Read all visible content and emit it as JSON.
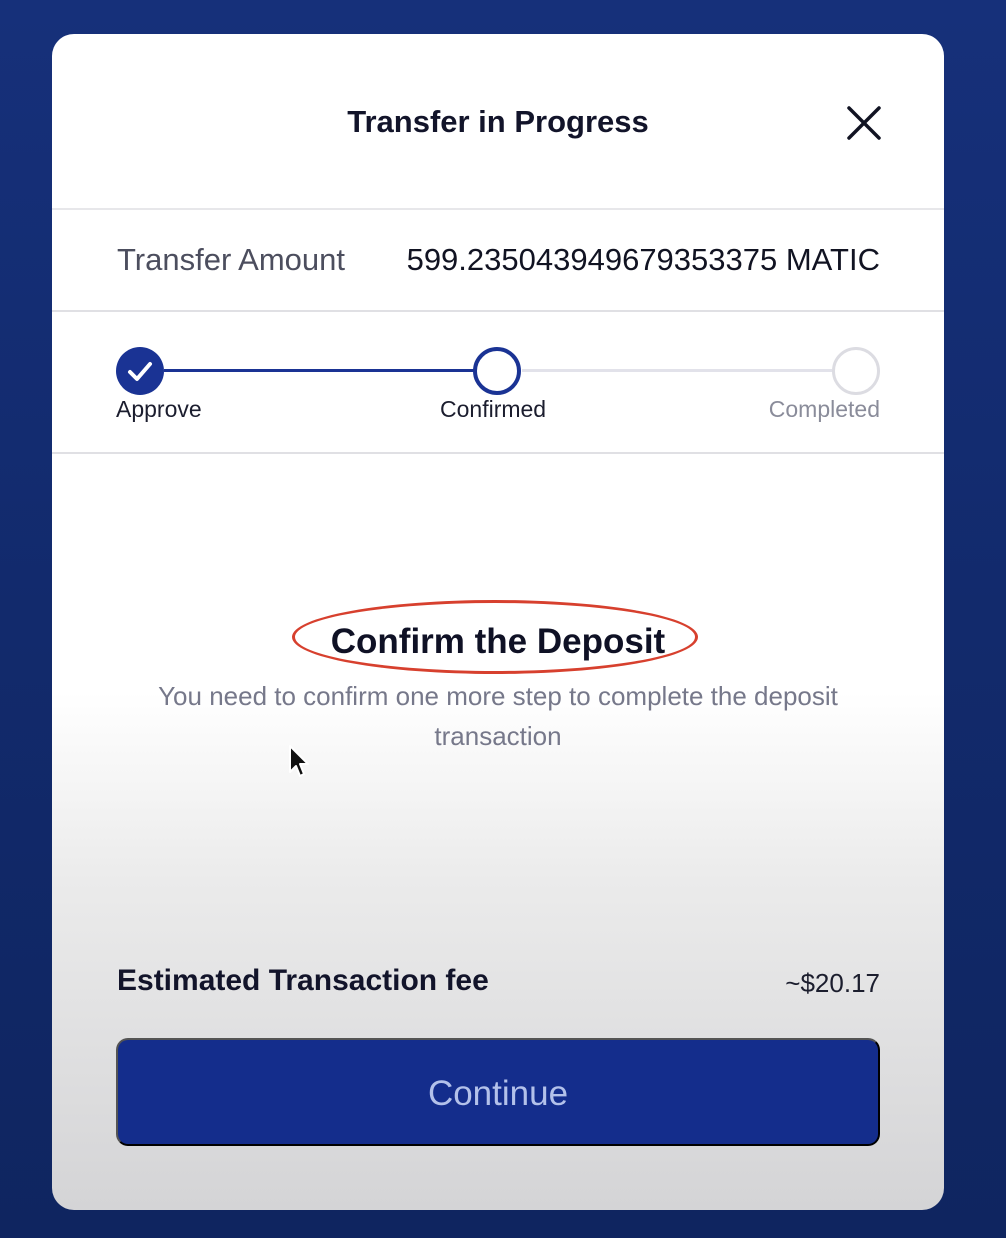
{
  "modal": {
    "title": "Transfer in Progress",
    "close_icon": "close-icon"
  },
  "transfer": {
    "label": "Transfer Amount",
    "value": "599.235043949679353375 MATIC"
  },
  "steps": [
    {
      "label": "Approve",
      "state": "done",
      "icon": "check-icon"
    },
    {
      "label": "Confirmed",
      "state": "current"
    },
    {
      "label": "Completed",
      "state": "pending"
    }
  ],
  "content": {
    "title": "Confirm the Deposit",
    "description": "You need to confirm one more step to complete the deposit transaction"
  },
  "fee": {
    "label": "Estimated Transaction fee",
    "value": "~$20.17"
  },
  "actions": {
    "continue_label": "Continue"
  },
  "colors": {
    "accent": "#1a3394",
    "annotation": "#d7402e",
    "background": "#142d7a"
  }
}
